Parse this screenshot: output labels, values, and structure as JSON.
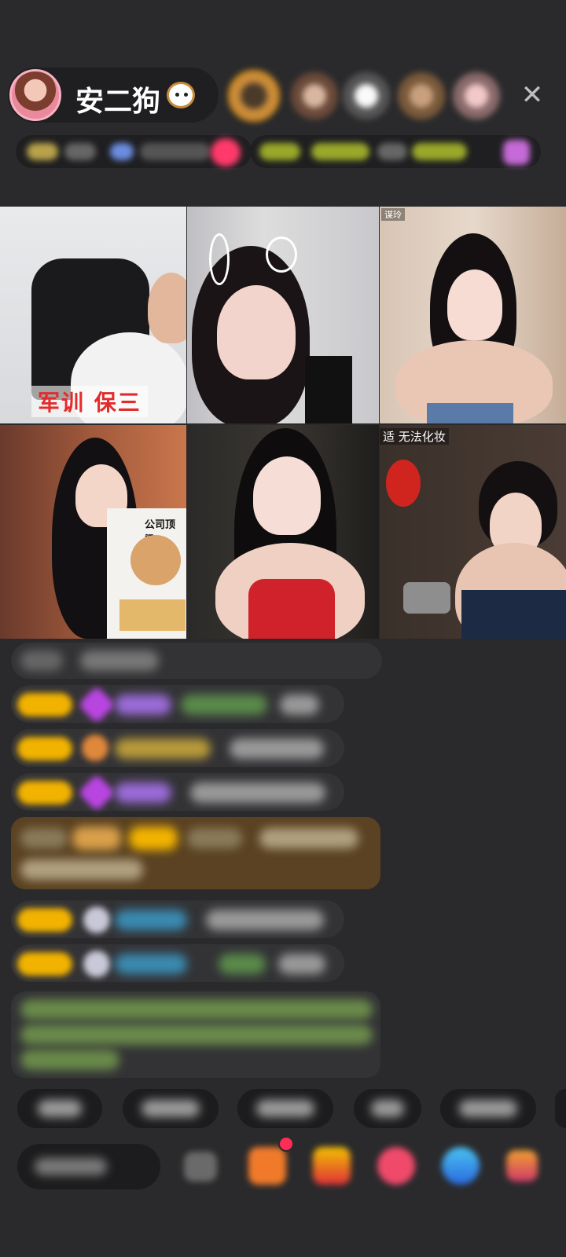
{
  "host": {
    "name": "安二狗",
    "emoji_icon": "puppy-face-icon"
  },
  "header": {
    "close_icon": "close-icon",
    "close_glyph": "✕"
  },
  "video_grid": {
    "cells": [
      {
        "label": "军训 保三",
        "tag": ""
      },
      {
        "label": "",
        "tag": ""
      },
      {
        "label": "",
        "tag": "谋玲"
      },
      {
        "label": "",
        "tag": ""
      },
      {
        "label": "",
        "tag": "公司顶梁"
      },
      {
        "label": "",
        "tag": "适 无法化妆"
      }
    ]
  },
  "colors": {
    "background": "#2a2a2c",
    "badge_gold": "#f2b300",
    "accent_pink": "#ff2d55"
  }
}
